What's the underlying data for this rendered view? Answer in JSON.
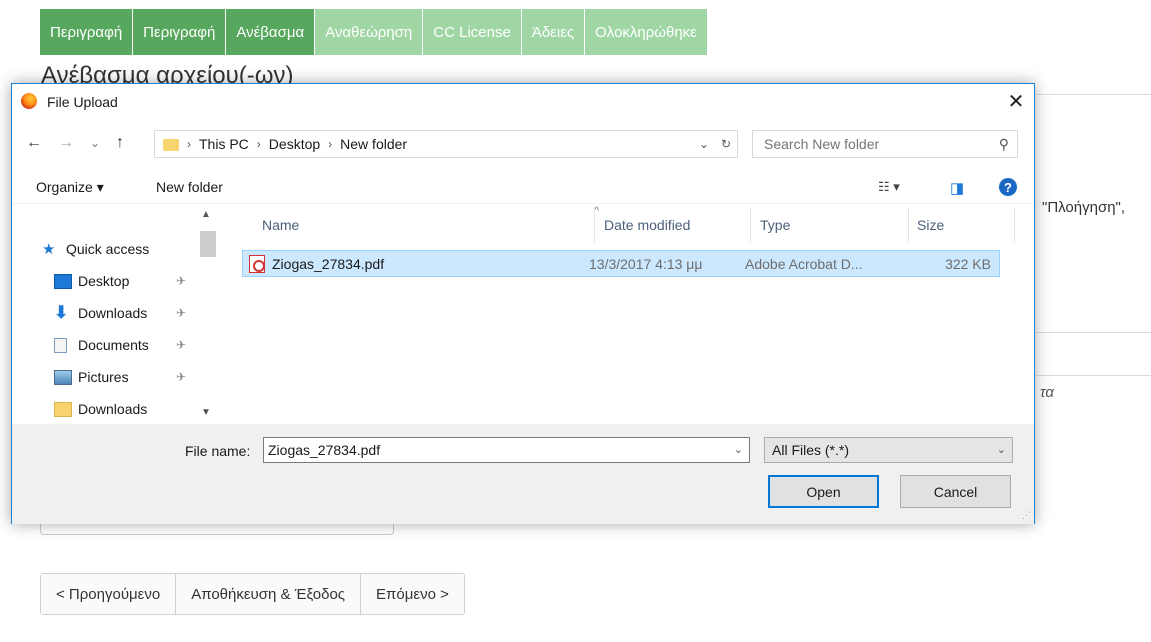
{
  "wizard": {
    "steps": [
      {
        "label": "Περιγραφή",
        "state": "done"
      },
      {
        "label": "Περιγραφή",
        "state": "done"
      },
      {
        "label": "Ανέβασμα",
        "state": "done"
      },
      {
        "label": "Αναθεώρηση",
        "state": "todo"
      },
      {
        "label": "CC License",
        "state": "todo"
      },
      {
        "label": "Άδειες",
        "state": "todo"
      },
      {
        "label": "Ολοκληρώθηκε",
        "state": "todo"
      }
    ],
    "heading": "Ανέβασμα αρχείου(-ων)",
    "side_text": "\"Πλοήγηση\",",
    "side_italic": "τα",
    "nav": {
      "prev_label": "< Προηγούμενο",
      "save_label": "Αποθήκευση & Έξοδος",
      "next_label": "Επόμενο >"
    },
    "colors": {
      "step_done": "#57a85e",
      "step_todo": "#9fd6a4"
    }
  },
  "dialog": {
    "title": "File Upload",
    "close_glyph": "✕",
    "address": {
      "back_glyph": "←",
      "forward_glyph": "→",
      "recent_glyph": "⌄",
      "up_glyph": "↑",
      "crumbs": [
        "This PC",
        "Desktop",
        "New folder"
      ],
      "separator": "›",
      "dropdown_glyph": "⌄",
      "refresh_glyph": "↻"
    },
    "search": {
      "placeholder": "Search New folder",
      "icon": "search-icon",
      "glyph": "⚲"
    },
    "toolbar": {
      "organize_label": "Organize ▾",
      "new_folder_label": "New folder",
      "view_glyph": "☷ ▾",
      "preview_glyph": "◨",
      "help_glyph": "?"
    },
    "nav_pane": {
      "items": [
        {
          "label": "Quick access",
          "icon": "star-icon",
          "glyph": "★",
          "pinned": false
        },
        {
          "label": "Desktop",
          "icon": "desktop-icon",
          "glyph": "",
          "pinned": true
        },
        {
          "label": "Downloads",
          "icon": "download-arrow-icon",
          "glyph": "⬇",
          "pinned": true
        },
        {
          "label": "Documents",
          "icon": "document-icon",
          "glyph": "",
          "pinned": true
        },
        {
          "label": "Pictures",
          "icon": "pictures-icon",
          "glyph": "",
          "pinned": true
        },
        {
          "label": "Downloads",
          "icon": "folder-icon",
          "glyph": "",
          "pinned": false
        }
      ],
      "pin_glyph": "✈",
      "scroll_up": "▲",
      "scroll_down": "▼"
    },
    "columns": {
      "name": "Name",
      "date": "Date modified",
      "type": "Type",
      "size": "Size",
      "sort_glyph": "^"
    },
    "files": [
      {
        "name": "Ziogas_27834.pdf",
        "date": "13/3/2017 4:13 μμ",
        "type": "Adobe Acrobat D...",
        "size": "322 KB",
        "icon": "pdf-icon",
        "selected": true
      }
    ],
    "file_name_label": "File name:",
    "file_name_value": "Ziogas_27834.pdf",
    "file_type": "All Files (*.*)",
    "dropdown_glyph": "⌄",
    "open_label": "Open",
    "cancel_label": "Cancel",
    "accent_color": "#0078d7"
  }
}
